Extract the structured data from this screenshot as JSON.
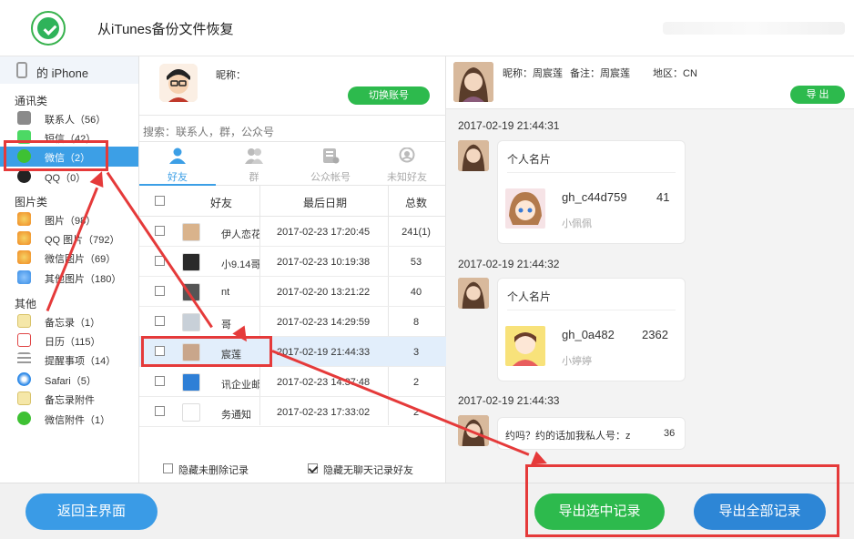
{
  "window": {
    "title": "从iTunes备份文件恢复"
  },
  "sidebar": {
    "device": "的 iPhone",
    "groups": [
      {
        "title": "通讯类",
        "items": [
          {
            "label": "联系人（56）",
            "icon": "contacts-icon",
            "color": "#8a8a8a"
          },
          {
            "label": "短信（42）",
            "icon": "sms-icon",
            "color": "#4cd964"
          },
          {
            "label": "微信（2）",
            "icon": "wechat-icon",
            "color": "#3ec133",
            "active": true
          },
          {
            "label": "QQ（0）",
            "icon": "qq-icon",
            "color": "#222222"
          }
        ]
      },
      {
        "title": "图片类",
        "items": [
          {
            "label": "图片（98）",
            "icon": "photos-icon",
            "color": "#f0a020"
          },
          {
            "label": "QQ 图片（792）",
            "icon": "qq-photos-icon",
            "color": "#f0a020"
          },
          {
            "label": "微信图片（69）",
            "icon": "wechat-photos-icon",
            "color": "#f0a020"
          },
          {
            "label": "其他图片（180）",
            "icon": "other-photos-icon",
            "color": "#3a8ee6"
          }
        ]
      },
      {
        "title": "其他",
        "items": [
          {
            "label": "备忘录（1）",
            "icon": "notes-icon",
            "color": "#e8c867"
          },
          {
            "label": "日历（115）",
            "icon": "calendar-icon",
            "color": "#e04646"
          },
          {
            "label": "提醒事项（14）",
            "icon": "reminders-icon",
            "color": "#999999"
          },
          {
            "label": "Safari（5）",
            "icon": "safari-icon",
            "color": "#2f8ae8"
          },
          {
            "label": "备忘录附件",
            "icon": "notes-attachment-icon",
            "color": "#e8c867"
          },
          {
            "label": "微信附件（1）",
            "icon": "wechat-attachment-icon",
            "color": "#3ec133"
          }
        ]
      }
    ]
  },
  "account": {
    "nick_label": "昵称：",
    "switch_button": "切换账号"
  },
  "search": {
    "placeholder": "搜索：联系人，群，公众号"
  },
  "tabs": [
    {
      "label": "好友",
      "icon": "friend-icon",
      "active": true
    },
    {
      "label": "群",
      "icon": "group-icon"
    },
    {
      "label": "公众帐号",
      "icon": "official-account-icon"
    },
    {
      "label": "未知好友",
      "icon": "unknown-friend-icon"
    }
  ],
  "table": {
    "headers": [
      "好友",
      "最后日期",
      "总数"
    ],
    "rows": [
      {
        "name": "伊人恋花",
        "date": "2017-02-23 17:20:45",
        "total": "241(1)",
        "color": "#d9b38c"
      },
      {
        "name": "小9.14哥",
        "date": "2017-02-23 10:19:38",
        "total": "53",
        "color": "#2a2a2a"
      },
      {
        "name": "nt",
        "date": "2017-02-20 13:21:22",
        "total": "40",
        "color": "#555555"
      },
      {
        "name": "哥",
        "date": "2017-02-23 14:29:59",
        "total": "8",
        "color": "#c8d0d8"
      },
      {
        "name": "宸莲",
        "date": "2017-02-19 21:44:33",
        "total": "3",
        "color": "#c9a68b",
        "selected": true
      },
      {
        "name": "讯企业邮",
        "date": "2017-02-23 14:37:48",
        "total": "2",
        "color": "#2e7fd6"
      },
      {
        "name": "务通知",
        "date": "2017-02-23 17:33:02",
        "total": "2",
        "color": "#ffffff"
      }
    ]
  },
  "options": {
    "hide_deleted": "隐藏未删除记录",
    "hide_no_chat": "隐藏无聊天记录好友"
  },
  "chat": {
    "nickname": "昵称：周宸莲",
    "remark": "备注：周宸莲",
    "region": "地区：CN",
    "export_button": "导 出",
    "messages": [
      {
        "time": "2017-02-19 21:44:31",
        "card_title": "个人名片",
        "card_name": "gh_c44d759",
        "card_suffix": "41",
        "card_sub": "小佩佩"
      },
      {
        "time": "2017-02-19 21:44:32",
        "card_title": "个人名片",
        "card_name": "gh_0a482",
        "card_suffix": "2362",
        "card_sub": "小婷婷"
      },
      {
        "time": "2017-02-19 21:44:33",
        "text": "约吗？约的话加我私人号：z",
        "text_suffix": "36"
      }
    ]
  },
  "bottom": {
    "back_button": "返回主界面",
    "export_selected": "导出选中记录",
    "export_all": "导出全部记录"
  },
  "colors": {
    "accent_blue": "#3c9fe6",
    "green": "#2dba4d",
    "annotation_red": "#e53a3a"
  }
}
